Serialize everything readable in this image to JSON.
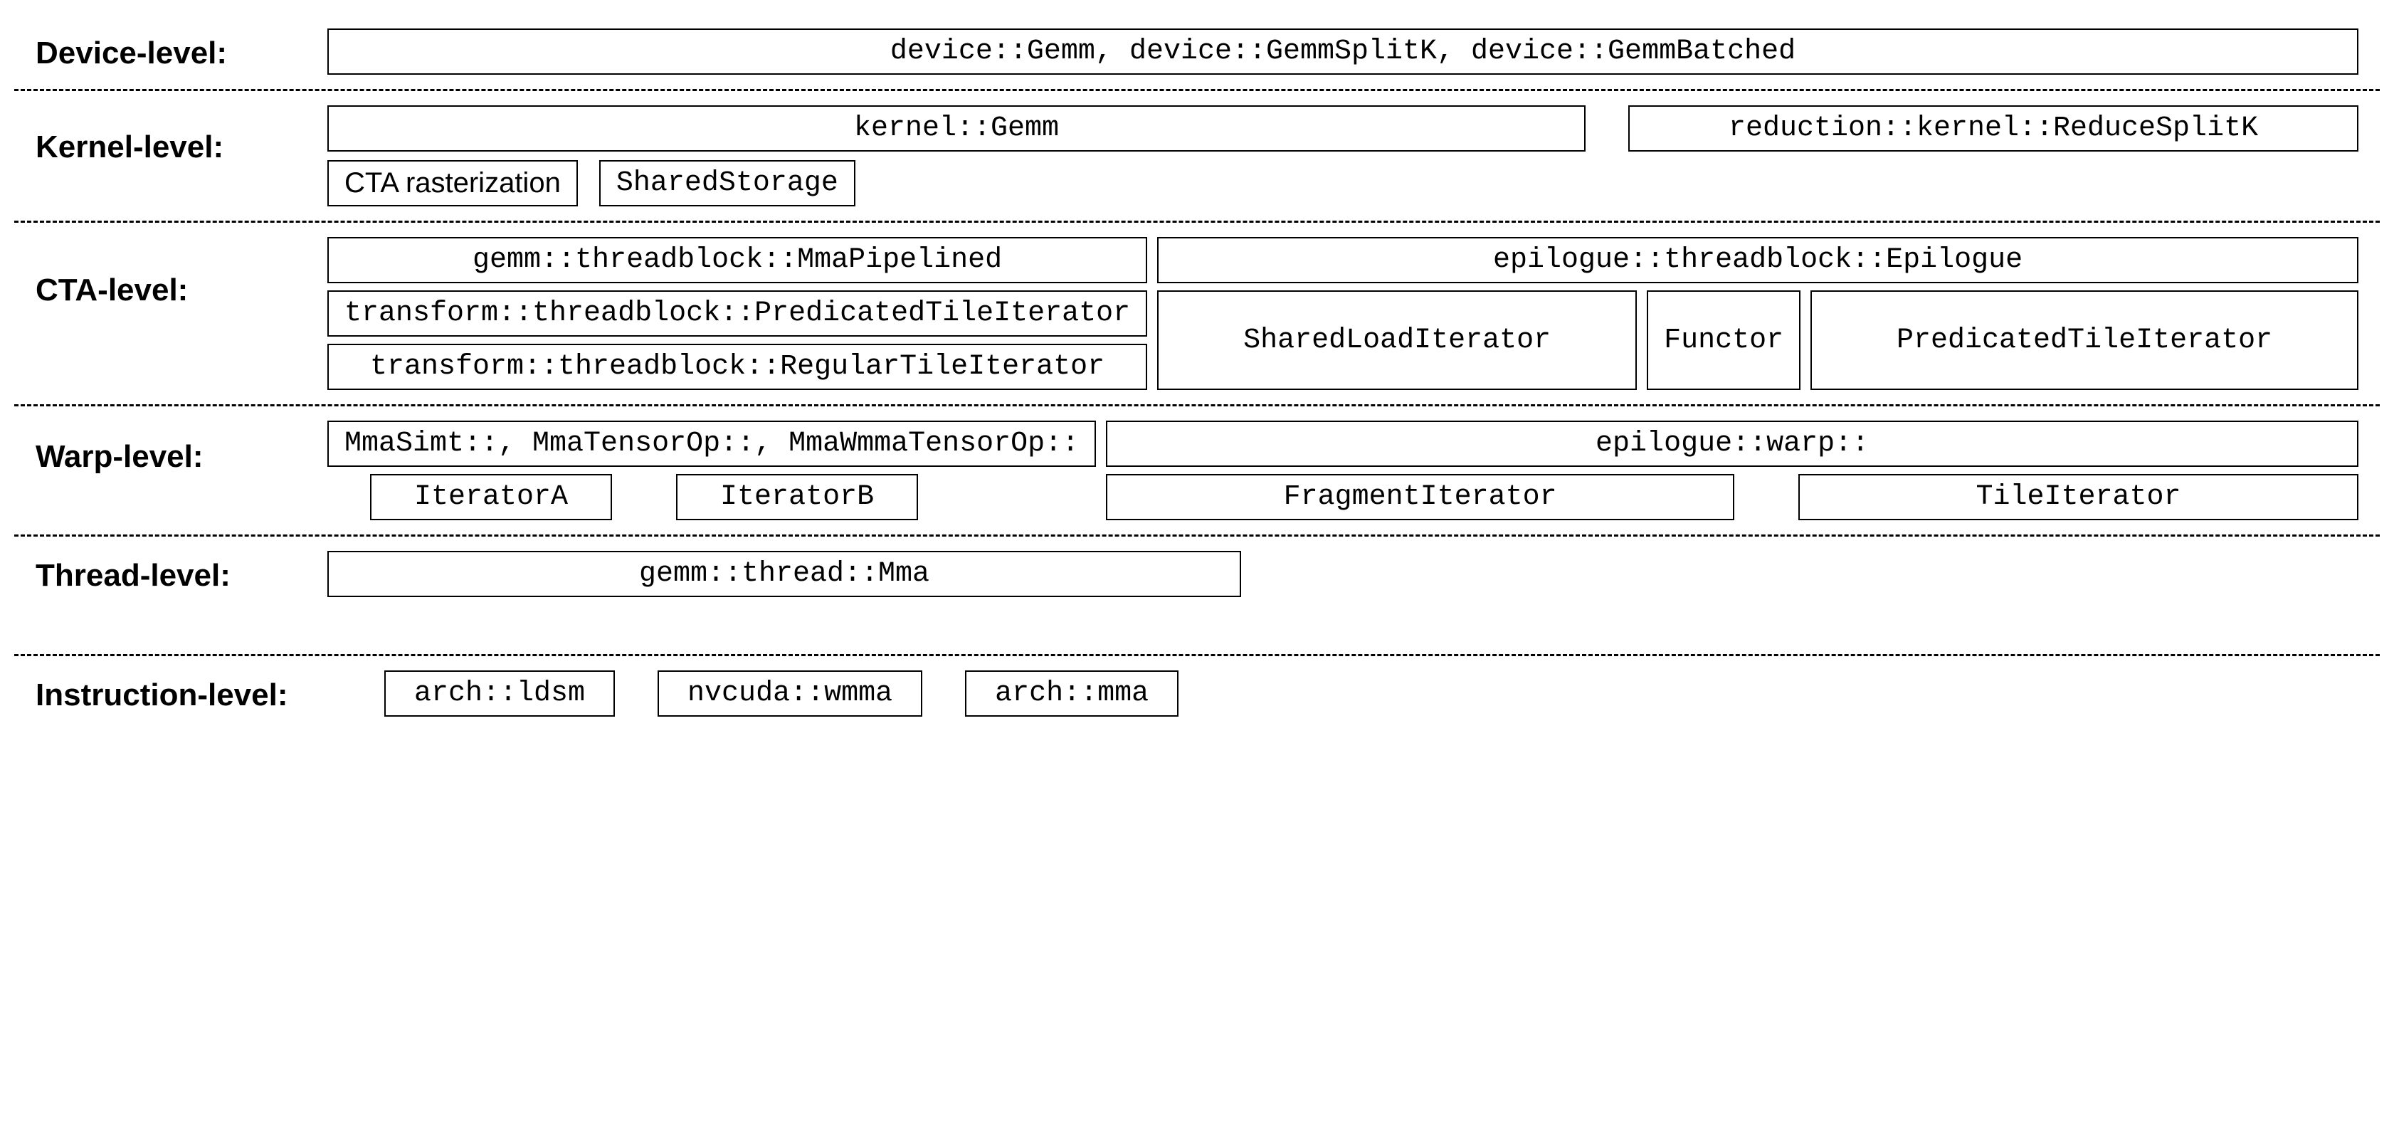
{
  "device": {
    "label": "Device-level:",
    "items": [
      "device::Gemm, device::GemmSplitK, device::GemmBatched"
    ]
  },
  "kernel": {
    "label": "Kernel-level:",
    "row1": {
      "gemm": "kernel::Gemm",
      "reduce": "reduction::kernel::ReduceSplitK"
    },
    "row2": {
      "cta": "CTA rasterization",
      "shared": "SharedStorage"
    }
  },
  "cta": {
    "label": "CTA-level:",
    "left": {
      "r1": "gemm::threadblock::MmaPipelined",
      "r2": "transform::threadblock::PredicatedTileIterator",
      "r3": "transform::threadblock::RegularTileIterator"
    },
    "right": {
      "r1": "epilogue::threadblock::Epilogue",
      "r2a": "SharedLoadIterator",
      "r2b": "Functor",
      "r2c": "PredicatedTileIterator"
    }
  },
  "warp": {
    "label": "Warp-level:",
    "left": {
      "r1": "MmaSimt::, MmaTensorOp::, MmaWmmaTensorOp::",
      "r2a": "IteratorA",
      "r2b": "IteratorB"
    },
    "right": {
      "r1": "epilogue::warp::",
      "r2a": "FragmentIterator",
      "r2b": "TileIterator"
    }
  },
  "thread": {
    "label": "Thread-level:",
    "item": "gemm::thread::Mma"
  },
  "instruction": {
    "label": "Instruction-level:",
    "items": [
      "arch::ldsm",
      "nvcuda::wmma",
      "arch::mma"
    ]
  }
}
